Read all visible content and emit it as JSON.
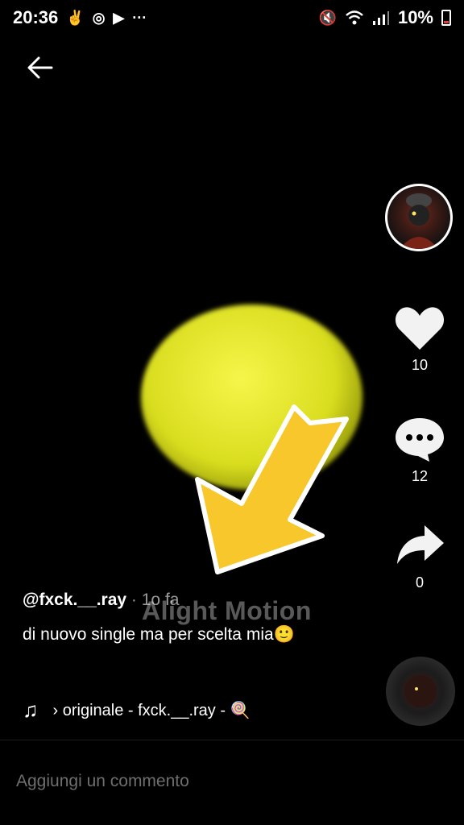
{
  "status_bar": {
    "time": "20:36",
    "battery": "10%",
    "icons_left": [
      "hand-icon",
      "signal-app-icon",
      "youtube-icon",
      "more-dots-icon"
    ],
    "icons_right": [
      "mute-icon",
      "wifi-icon",
      "cell-signal-icon",
      "battery-icon"
    ],
    "more": "···"
  },
  "video": {
    "watermark": "Alight Motion"
  },
  "actions": {
    "likes": "10",
    "comments": "12",
    "shares": "0"
  },
  "post": {
    "username": "@fxck.__.ray",
    "separator": " · ",
    "time": "1o fa",
    "description": "di nuovo single ma per scelta mia🙂",
    "music": "› originale - fxck.__.ray - 🍭"
  },
  "comment": {
    "placeholder": "Aggiungi un commento"
  },
  "colors": {
    "background": "#000000",
    "text": "#ffffff",
    "muted": "#6e6e6e",
    "arrow": "#f7c72c",
    "battery_low": "#e53935"
  }
}
